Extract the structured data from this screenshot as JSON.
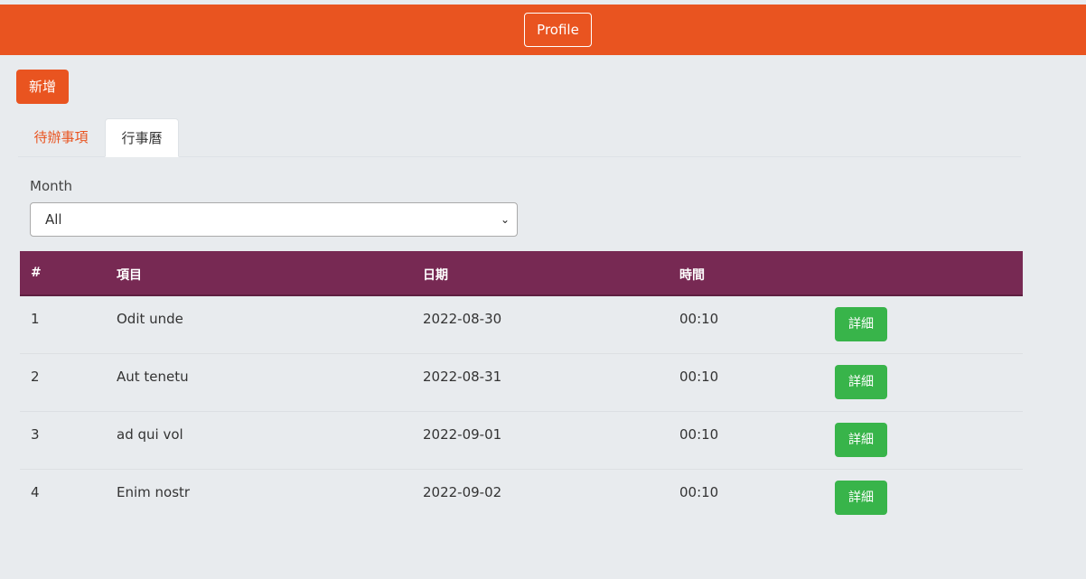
{
  "header": {
    "profile_label": "Profile",
    "accent_color": "#e95420"
  },
  "actions": {
    "add_label": "新增"
  },
  "tabs": [
    {
      "label": "待辦事項",
      "active": false
    },
    {
      "label": "行事曆",
      "active": true
    }
  ],
  "filter": {
    "label": "Month",
    "selected": "All"
  },
  "table": {
    "header_color": "#772953",
    "columns": [
      "#",
      "項目",
      "日期",
      "時間",
      ""
    ],
    "rows": [
      {
        "num": "1",
        "item": "Odit unde",
        "date": "2022-08-30",
        "time": "00:10",
        "action": "詳細"
      },
      {
        "num": "2",
        "item": "Aut tenetu",
        "date": "2022-08-31",
        "time": "00:10",
        "action": "詳細"
      },
      {
        "num": "3",
        "item": "ad qui vol",
        "date": "2022-09-01",
        "time": "00:10",
        "action": "詳細"
      },
      {
        "num": "4",
        "item": "Enim nostr",
        "date": "2022-09-02",
        "time": "00:10",
        "action": "詳細"
      }
    ],
    "action_color": "#38b44a"
  }
}
